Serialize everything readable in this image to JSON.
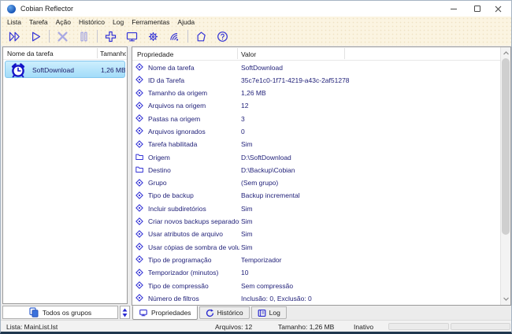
{
  "window": {
    "title": "Cobian Reflector"
  },
  "colors": {
    "accent_blue": "#3434d6",
    "disabled_blue": "#a9a9e2",
    "deep_blue": "#1414c8",
    "cream_background": "#fbf4e1",
    "selection_blue": "#a2dcf9",
    "text_navy": "#23237a"
  },
  "menu": {
    "items": [
      "Lista",
      "Tarefa",
      "Ação",
      "Histórico",
      "Log",
      "Ferramentas",
      "Ajuda"
    ]
  },
  "toolbar": {
    "icons": [
      "run-all-icon",
      "run-icon",
      "abort-icon",
      "pause-icon",
      "new-task-icon",
      "monitor-icon",
      "settings-gear-icon",
      "remote-signal-icon",
      "document-icon",
      "help-icon"
    ]
  },
  "task_list": {
    "name_header": "Nome da tarefa",
    "size_header": "Tamanho",
    "tasks": [
      {
        "name": "SoftDownload",
        "size": "1,26 MB"
      }
    ]
  },
  "properties_panel": {
    "property_header": "Propriedade",
    "value_header": "Valor",
    "rows": [
      {
        "icon": "dot",
        "label": "Nome da tarefa",
        "value": "SoftDownload"
      },
      {
        "icon": "dot",
        "label": "ID da Tarefa",
        "value": "35c7e1c0-1f71-4219-a43c-2af51278"
      },
      {
        "icon": "dot",
        "label": "Tamanho da origem",
        "value": "1,26 MB"
      },
      {
        "icon": "dot",
        "label": "Arquivos na origem",
        "value": "12"
      },
      {
        "icon": "dot",
        "label": "Pastas na origem",
        "value": "3"
      },
      {
        "icon": "dot",
        "label": "Arquivos ignorados",
        "value": "0"
      },
      {
        "icon": "dot",
        "label": "Tarefa habilitada",
        "value": "Sim"
      },
      {
        "icon": "folder",
        "label": "Origem",
        "value": "D:\\SoftDownload"
      },
      {
        "icon": "folder",
        "label": "Destino",
        "value": "D:\\Backup\\Cobian"
      },
      {
        "icon": "dot",
        "label": "Grupo",
        "value": "(Sem grupo)"
      },
      {
        "icon": "dot",
        "label": "Tipo de backup",
        "value": "Backup incremental"
      },
      {
        "icon": "dot",
        "label": "Incluir subdiretórios",
        "value": "Sim"
      },
      {
        "icon": "dot",
        "label": "Criar novos backups separados",
        "value": "Sim"
      },
      {
        "icon": "dot",
        "label": "Usar atributos de arquivo",
        "value": "Sim"
      },
      {
        "icon": "dot",
        "label": "Usar cópias de sombra de volume",
        "value": "Sim"
      },
      {
        "icon": "dot",
        "label": "Tipo de programação",
        "value": "Temporizador"
      },
      {
        "icon": "dot",
        "label": "Temporizador (minutos)",
        "value": "10"
      },
      {
        "icon": "dot",
        "label": "Tipo de compressão",
        "value": "Sem compressão"
      },
      {
        "icon": "dot",
        "label": "Número de filtros",
        "value": "Inclusão: 0, Exclusão: 0"
      }
    ]
  },
  "groups_bar": {
    "label": "Todos os grupos"
  },
  "tabs": {
    "items": [
      {
        "label": "Propriedades",
        "active": true
      },
      {
        "label": "Histórico",
        "active": false
      },
      {
        "label": "Log",
        "active": false
      }
    ]
  },
  "status_bar": {
    "list_label": "Lista: MainList.lst",
    "files": "Arquivos: 12",
    "size": "Tamanho: 1,26 MB",
    "state": "Inativo"
  }
}
